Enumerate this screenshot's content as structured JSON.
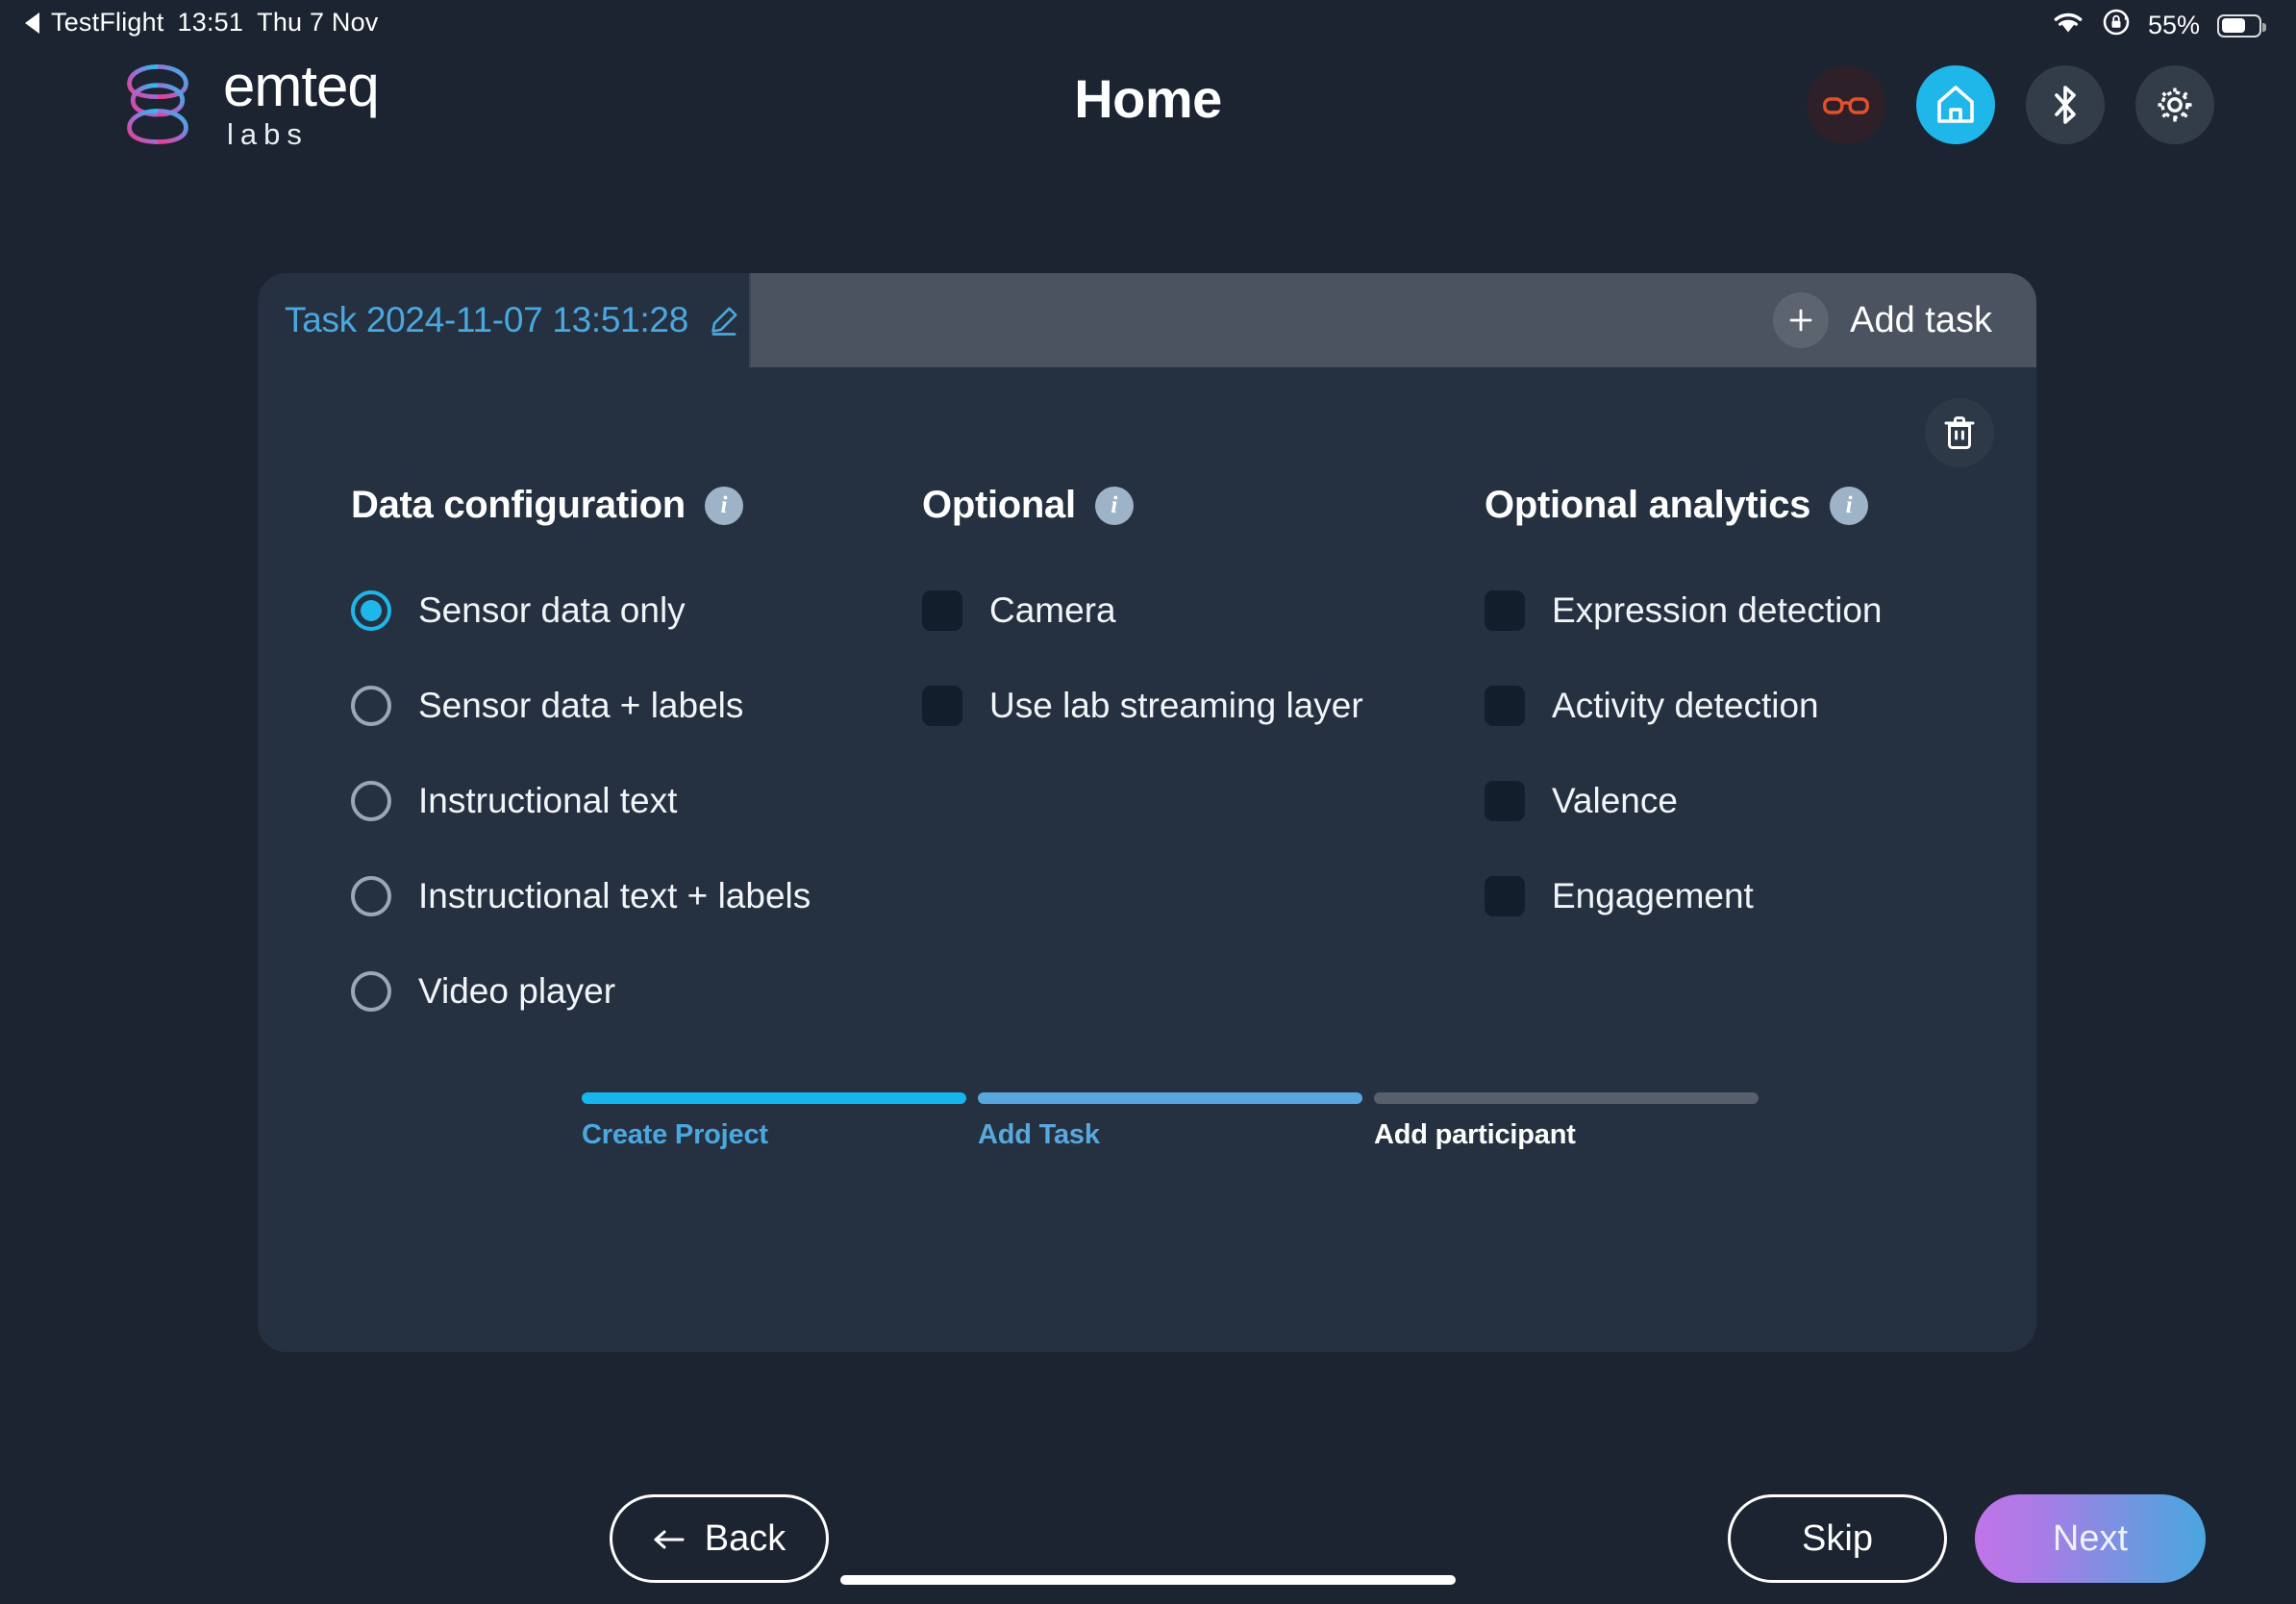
{
  "status_bar": {
    "back_app": "TestFlight",
    "time": "13:51",
    "date": "Thu 7 Nov",
    "battery_percent": "55%",
    "wifi_icon": "wifi-icon",
    "rotation_lock_icon": "rotation-lock-icon",
    "battery_icon": "battery-icon"
  },
  "header": {
    "logo_word": "emteq",
    "logo_sub": "labs",
    "title": "Home",
    "icons": [
      {
        "name": "glasses-icon",
        "label": "Glasses",
        "active": false,
        "color": "#e4502a"
      },
      {
        "name": "home-icon",
        "label": "Home",
        "active": true,
        "color": "#1fb6ea"
      },
      {
        "name": "bluetooth-icon",
        "label": "Bluetooth",
        "active": false,
        "color": "#ffffff"
      },
      {
        "name": "gear-icon",
        "label": "Settings",
        "active": false,
        "color": "#ffffff"
      }
    ]
  },
  "card": {
    "task_tab": {
      "label": "Task 2024-11-07 13:51:28",
      "edit_icon": "pencil-icon"
    },
    "add_task": {
      "label": "Add task",
      "icon": "plus-icon"
    },
    "delete_icon": "trash-icon",
    "columns": [
      {
        "heading": "Data configuration",
        "info_icon": "info-icon",
        "type": "radio",
        "options": [
          {
            "label": "Sensor data only",
            "selected": true
          },
          {
            "label": "Sensor data + labels",
            "selected": false
          },
          {
            "label": "Instructional text",
            "selected": false
          },
          {
            "label": "Instructional text + labels",
            "selected": false
          },
          {
            "label": "Video player",
            "selected": false
          }
        ]
      },
      {
        "heading": "Optional",
        "info_icon": "info-icon",
        "type": "checkbox",
        "options": [
          {
            "label": "Camera",
            "checked": false
          },
          {
            "label": "Use lab streaming layer",
            "checked": false
          }
        ]
      },
      {
        "heading": "Optional analytics",
        "info_icon": "info-icon",
        "type": "checkbox",
        "options": [
          {
            "label": "Expression detection",
            "checked": false
          },
          {
            "label": "Activity detection",
            "checked": false
          },
          {
            "label": "Valence",
            "checked": false
          },
          {
            "label": "Engagement",
            "checked": false
          }
        ]
      }
    ],
    "steps": [
      {
        "label": "Create Project",
        "state": "complete",
        "color": "#16b5ee"
      },
      {
        "label": "Add Task",
        "state": "active",
        "color": "#59a8dd"
      },
      {
        "label": "Add participant",
        "state": "pending",
        "color": "#565f6b"
      }
    ],
    "buttons": {
      "back": "Back",
      "back_icon": "arrow-left-icon",
      "skip": "Skip",
      "next": "Next"
    }
  },
  "colors": {
    "page_background": "#1b2430",
    "card_background": "#253140",
    "accent_cyan": "#1fb6ea",
    "add_task_bar": "#4a535f",
    "next_gradient_start": "#c173e8",
    "next_gradient_end": "#4aa6df"
  }
}
